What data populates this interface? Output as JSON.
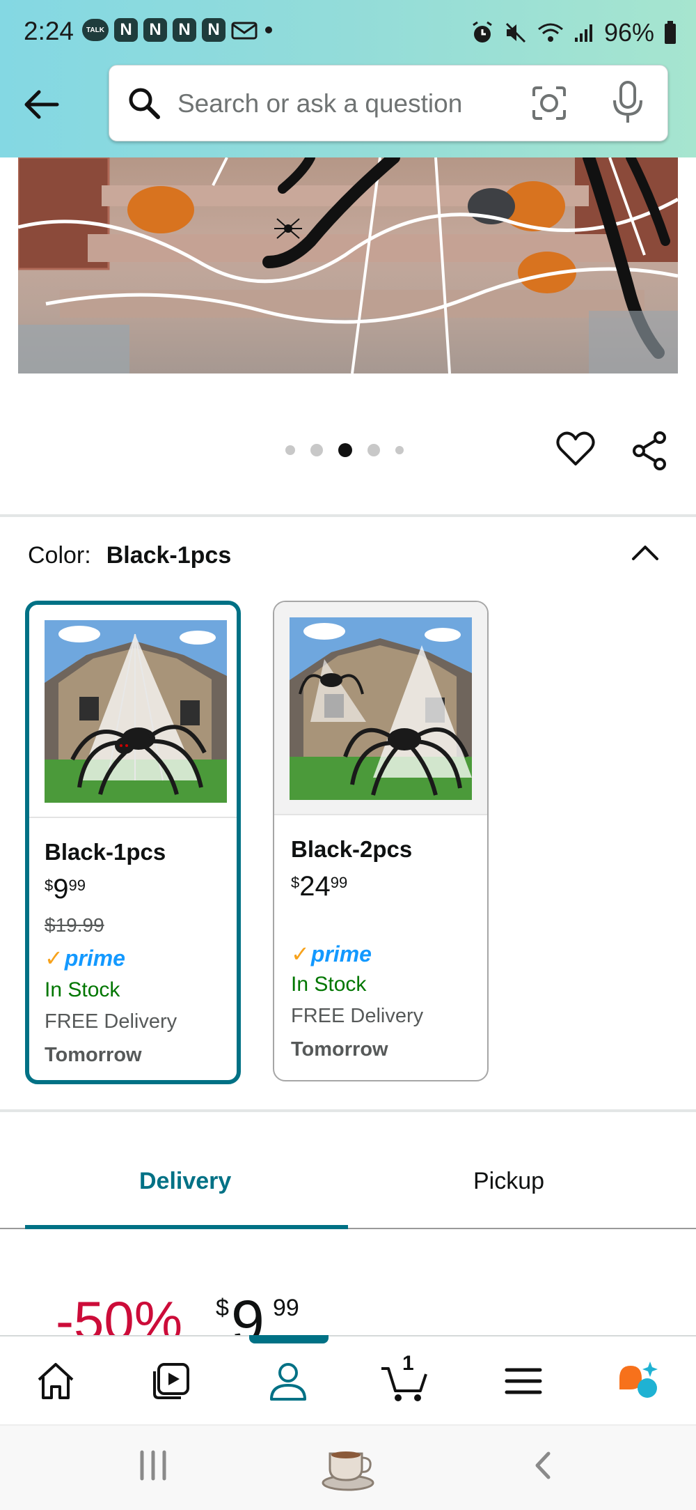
{
  "status_bar": {
    "time": "2:24",
    "talk_label": "TALK",
    "n_icon": "N",
    "battery": "96%"
  },
  "search": {
    "placeholder": "Search or ask a question"
  },
  "carousel": {
    "dots": 5,
    "active_index": 2
  },
  "color_selector": {
    "label": "Color:",
    "selected": "Black-1pcs"
  },
  "options": [
    {
      "name": "Black-1pcs",
      "price_currency": "$",
      "price_whole": "9",
      "price_fraction": "99",
      "list_price": "$19.99",
      "prime": "prime",
      "stock": "In Stock",
      "delivery": "FREE Delivery",
      "delivery_day": "Tomorrow"
    },
    {
      "name": "Black-2pcs",
      "price_currency": "$",
      "price_whole": "24",
      "price_fraction": "99",
      "prime": "prime",
      "stock": "In Stock",
      "delivery": "FREE Delivery",
      "delivery_day": "Tomorrow"
    }
  ],
  "tabs": {
    "delivery": "Delivery",
    "pickup": "Pickup"
  },
  "price_block": {
    "discount": "-50%",
    "currency": "$",
    "whole": "9",
    "fraction": "99"
  },
  "bottom_nav": {
    "cart_count": "1",
    "active": "profile",
    "items": [
      "home-icon",
      "video-icon",
      "profile-icon",
      "cart-icon",
      "menu-icon",
      "rufus-icon"
    ]
  },
  "colors": {
    "accent": "#007185",
    "discount": "#cc0c39",
    "stock": "#007600",
    "prime": "#1399ff"
  }
}
